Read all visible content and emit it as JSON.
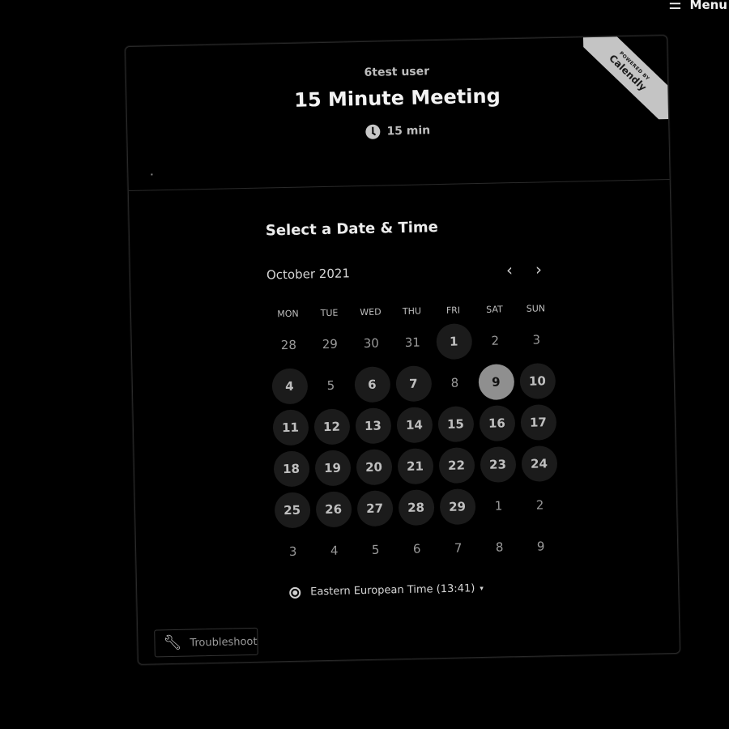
{
  "menu": {
    "label": "Menu"
  },
  "event": {
    "owner": "6test user",
    "title": "15 Minute Meeting",
    "duration": "15 min"
  },
  "badge": {
    "line1": "POWERED BY",
    "line2": "Calendly"
  },
  "picker": {
    "heading": "Select a Date & Time",
    "month": "October 2021",
    "weekdays": [
      "MON",
      "TUE",
      "WED",
      "THU",
      "FRI",
      "SAT",
      "SUN"
    ],
    "weeks": [
      [
        {
          "d": "28",
          "s": "other"
        },
        {
          "d": "29",
          "s": "other"
        },
        {
          "d": "30",
          "s": "other"
        },
        {
          "d": "31",
          "s": "other"
        },
        {
          "d": "1",
          "s": "avail"
        },
        {
          "d": "2",
          "s": "off"
        },
        {
          "d": "3",
          "s": "off"
        }
      ],
      [
        {
          "d": "4",
          "s": "avail"
        },
        {
          "d": "5",
          "s": "off"
        },
        {
          "d": "6",
          "s": "avail"
        },
        {
          "d": "7",
          "s": "avail"
        },
        {
          "d": "8",
          "s": "off"
        },
        {
          "d": "9",
          "s": "selected"
        },
        {
          "d": "10",
          "s": "avail"
        }
      ],
      [
        {
          "d": "11",
          "s": "avail"
        },
        {
          "d": "12",
          "s": "avail"
        },
        {
          "d": "13",
          "s": "avail"
        },
        {
          "d": "14",
          "s": "avail"
        },
        {
          "d": "15",
          "s": "avail"
        },
        {
          "d": "16",
          "s": "avail"
        },
        {
          "d": "17",
          "s": "avail"
        }
      ],
      [
        {
          "d": "18",
          "s": "avail"
        },
        {
          "d": "19",
          "s": "avail"
        },
        {
          "d": "20",
          "s": "avail"
        },
        {
          "d": "21",
          "s": "avail"
        },
        {
          "d": "22",
          "s": "avail"
        },
        {
          "d": "23",
          "s": "avail"
        },
        {
          "d": "24",
          "s": "avail"
        }
      ],
      [
        {
          "d": "25",
          "s": "avail"
        },
        {
          "d": "26",
          "s": "avail"
        },
        {
          "d": "27",
          "s": "avail"
        },
        {
          "d": "28",
          "s": "avail"
        },
        {
          "d": "29",
          "s": "avail"
        },
        {
          "d": "1",
          "s": "other"
        },
        {
          "d": "2",
          "s": "other"
        }
      ],
      [
        {
          "d": "3",
          "s": "other"
        },
        {
          "d": "4",
          "s": "other"
        },
        {
          "d": "5",
          "s": "other"
        },
        {
          "d": "6",
          "s": "other"
        },
        {
          "d": "7",
          "s": "other"
        },
        {
          "d": "8",
          "s": "other"
        },
        {
          "d": "9",
          "s": "other"
        }
      ]
    ]
  },
  "timezone": {
    "label": "Eastern European Time (13:41)"
  },
  "troubleshoot": {
    "label": "Troubleshoot"
  },
  "icons": {
    "menu": "hamburger-icon",
    "clock": "clock-icon",
    "prev": "chevron-left-icon",
    "next": "chevron-right-icon",
    "globe": "globe-icon",
    "caret": "caret-down-icon",
    "wrench": "wrench-icon"
  },
  "colors": {
    "background": "#000000",
    "selected_day": "#8f8f8f",
    "available_day": "#1b1b1b",
    "badge": "#c4c4c4"
  }
}
